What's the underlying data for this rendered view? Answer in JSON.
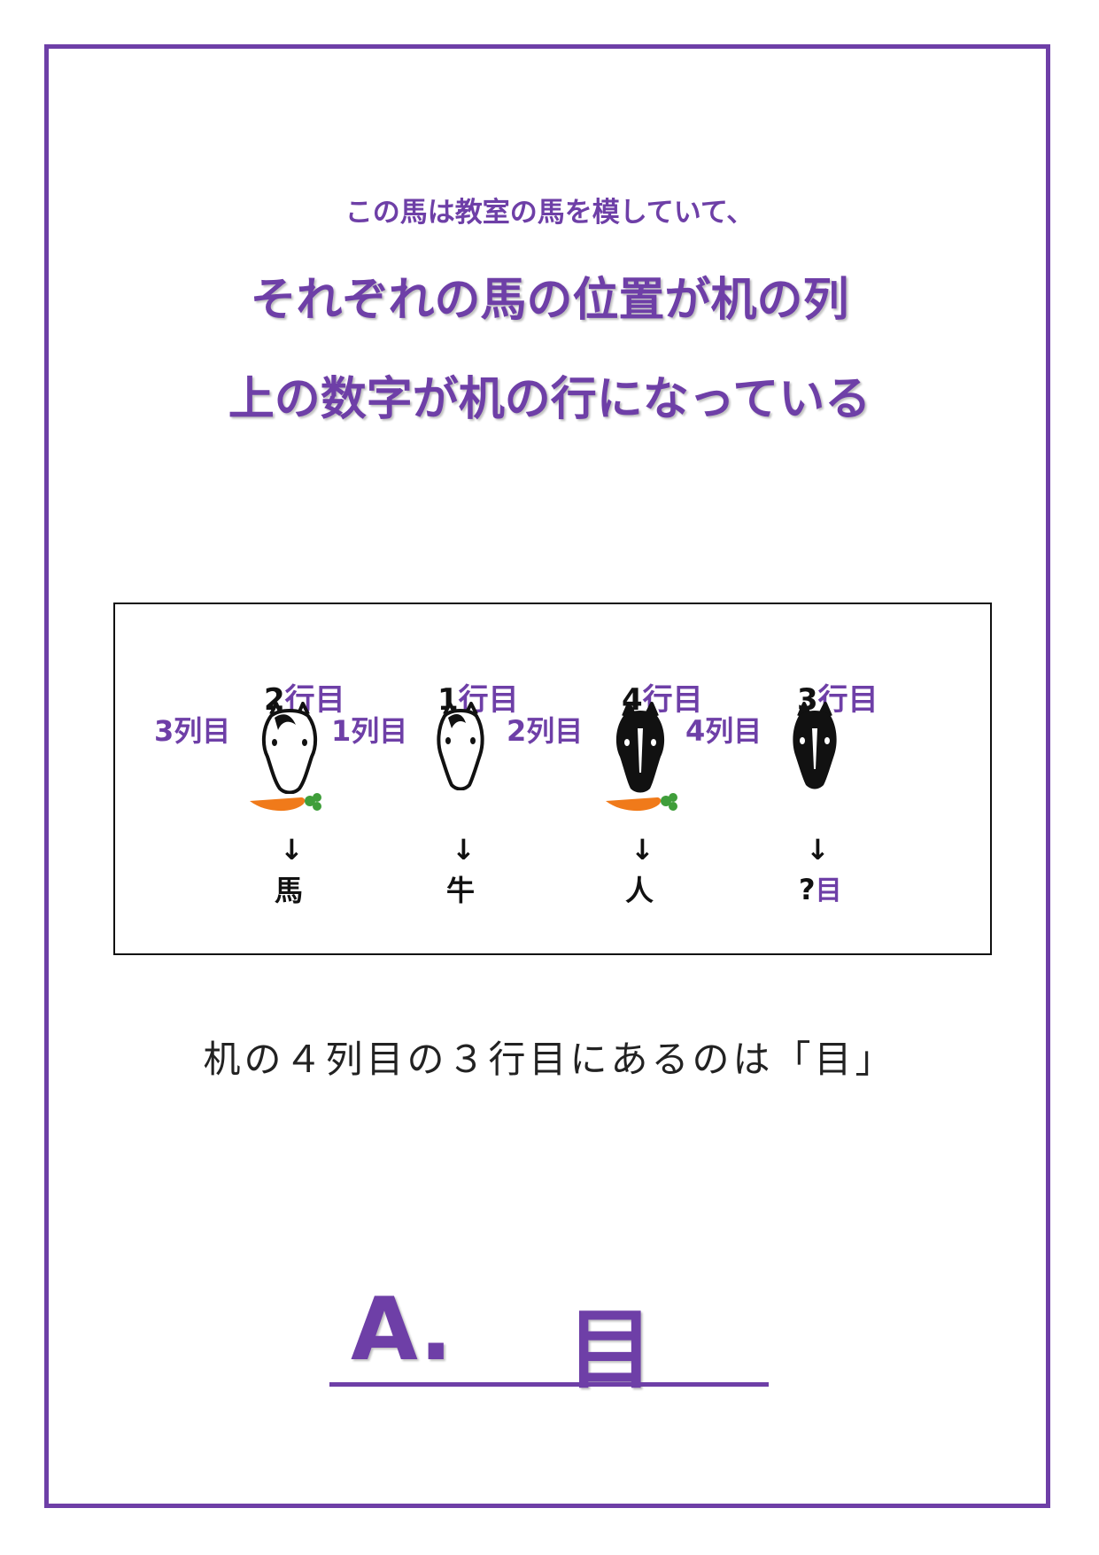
{
  "intro": "この馬は教室の馬を模していて、",
  "title_line1": "それぞれの馬の位置が机の列",
  "title_line2": "上の数字が机の行になっている",
  "horses": [
    {
      "row_num": "2",
      "row_suffix": "行目",
      "col": "3列目",
      "color": "white",
      "carrot": true,
      "arrow": "↓",
      "result": "馬",
      "result_extra": ""
    },
    {
      "row_num": "1",
      "row_suffix": "行目",
      "col": "1列目",
      "color": "white",
      "carrot": false,
      "arrow": "↓",
      "result": "牛",
      "result_extra": ""
    },
    {
      "row_num": "4",
      "row_suffix": "行目",
      "col": "2列目",
      "color": "black",
      "carrot": true,
      "arrow": "↓",
      "result": "人",
      "result_extra": ""
    },
    {
      "row_num": "3",
      "row_suffix": "行目",
      "col": "4列目",
      "color": "black",
      "carrot": false,
      "arrow": "↓",
      "result": "?",
      "result_extra": "目"
    }
  ],
  "explanation": "机の４列目の３行目にあるのは「目」",
  "answer_prefix": "A.",
  "answer_value": "目",
  "colors": {
    "accent": "#6e3fa7",
    "carrot": "#f07a1a",
    "leaf": "#3f9e3a"
  }
}
